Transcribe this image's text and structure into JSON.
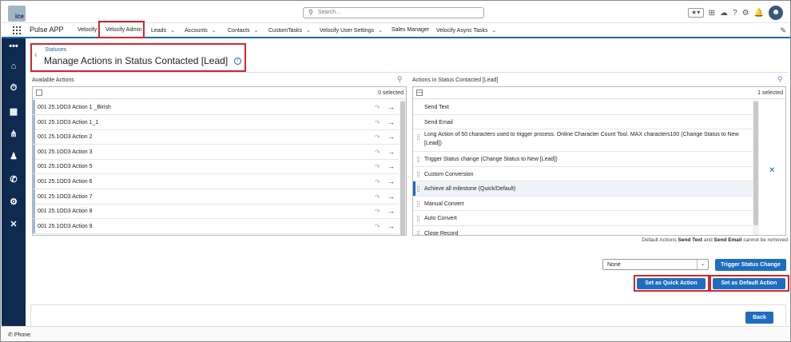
{
  "header": {
    "logo_text": "ice",
    "search_placeholder": "Search...",
    "icons": [
      "favorites-icon",
      "add-icon",
      "trailhead-icon",
      "help-icon",
      "settings-icon",
      "notifications-icon",
      "avatar"
    ]
  },
  "nav": {
    "app_name": "Pulse APP",
    "items": [
      {
        "label": "Velocify",
        "chev": false
      },
      {
        "label": "Velocify Admin",
        "chev": false
      },
      {
        "label": "Leads",
        "chev": true
      },
      {
        "label": "Accounts",
        "chev": true
      },
      {
        "label": "Contacts",
        "chev": true
      },
      {
        "label": "CustomTasks",
        "chev": true
      },
      {
        "label": "Velocify User Settings",
        "chev": true
      },
      {
        "label": "Sales Manager",
        "chev": false
      },
      {
        "label": "Velocify Async Tasks",
        "chev": true
      }
    ]
  },
  "page": {
    "breadcrumb": "Statuses",
    "title": "Manage Actions in Status Contacted [Lead]"
  },
  "available": {
    "title": "Available Actions",
    "selected_count": "0 selected",
    "items": [
      "001 25.1OD3 Action 1 _Birish",
      "001 25.1OD3 Action 1_1",
      "001 25.1OD3 Action 2",
      "001 25.1OD3 Action 3",
      "001 25.1OD3 Action 5",
      "001 25.1OD3 Action 6",
      "001 25.1OD3 Action 7",
      "001 25.1OD3 Action 8",
      "001 25.1OD3 Action 9"
    ]
  },
  "in_status": {
    "title": "Actions in Status Contacted [Lead]",
    "selected_count": "1 selected",
    "items": [
      {
        "line1": "Send Text",
        "line2": "",
        "selected": false
      },
      {
        "line1": "Send Email",
        "line2": "",
        "selected": false
      },
      {
        "line1": "Long Action of 50 characters used to trigger process. Online Character Count Tool. MAX characters100 (Change Status to New",
        "line2": "[Lead])",
        "selected": false
      },
      {
        "line1": "Trigger Status change (Change Status to New [Lead])",
        "line2": "",
        "selected": false
      },
      {
        "line1": "Custom Conversion",
        "line2": "",
        "selected": false
      },
      {
        "line1": "Achieve all milestone (Quick/Default)",
        "line2": "",
        "selected": true
      },
      {
        "line1": "Manual Convert",
        "line2": "",
        "selected": false
      },
      {
        "line1": "Auto Convert",
        "line2": "",
        "selected": false
      },
      {
        "line1": "Close Record",
        "line2": "",
        "selected": false
      }
    ]
  },
  "note": {
    "prefix": "Default Actions ",
    "a": "Send Text",
    "mid": " and ",
    "b": "Send Email",
    "suffix": " cannot be removed"
  },
  "controls": {
    "status_select_value": "None",
    "trigger_button": "Trigger Status Change",
    "quick_button": "Set as Quick Action",
    "default_button": "Set as Default Action",
    "back_button": "Back"
  },
  "utility": {
    "phone_label": "Phone"
  },
  "colors": {
    "brand": "#1f6dbf",
    "sidebar": "#0e2a4f",
    "highlight": "#d3262c"
  }
}
